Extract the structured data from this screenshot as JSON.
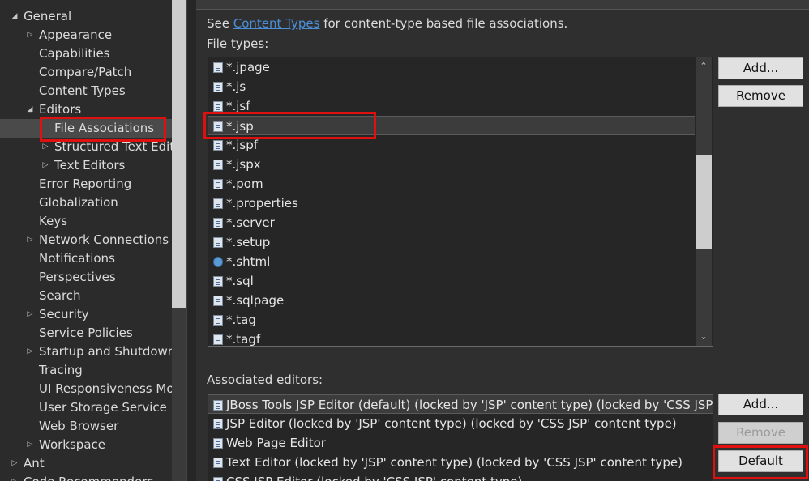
{
  "tree": {
    "items": [
      {
        "label": "General",
        "arrow": "◢"
      },
      {
        "label": "Appearance",
        "arrow": "▷"
      },
      {
        "label": "Capabilities",
        "arrow": ""
      },
      {
        "label": "Compare/Patch",
        "arrow": ""
      },
      {
        "label": "Content Types",
        "arrow": ""
      },
      {
        "label": "Editors",
        "arrow": "◢"
      },
      {
        "label": "File Associations",
        "arrow": ""
      },
      {
        "label": "Structured Text Editors",
        "arrow": "▷"
      },
      {
        "label": "Text Editors",
        "arrow": "▷"
      },
      {
        "label": "Error Reporting",
        "arrow": ""
      },
      {
        "label": "Globalization",
        "arrow": ""
      },
      {
        "label": "Keys",
        "arrow": ""
      },
      {
        "label": "Network Connections",
        "arrow": "▷"
      },
      {
        "label": "Notifications",
        "arrow": ""
      },
      {
        "label": "Perspectives",
        "arrow": ""
      },
      {
        "label": "Search",
        "arrow": ""
      },
      {
        "label": "Security",
        "arrow": "▷"
      },
      {
        "label": "Service Policies",
        "arrow": ""
      },
      {
        "label": "Startup and Shutdown",
        "arrow": "▷"
      },
      {
        "label": "Tracing",
        "arrow": ""
      },
      {
        "label": "UI Responsiveness Monitoring",
        "arrow": ""
      },
      {
        "label": "User Storage Service",
        "arrow": ""
      },
      {
        "label": "Web Browser",
        "arrow": ""
      },
      {
        "label": "Workspace",
        "arrow": "▷"
      },
      {
        "label": "Ant",
        "arrow": "▷"
      },
      {
        "label": "Code Recommenders",
        "arrow": "▷"
      }
    ],
    "selected_label": "File Associations"
  },
  "intro": {
    "prefix": "See ",
    "link": "Content Types",
    "suffix": " for content-type based file associations."
  },
  "file_types": {
    "label": "File types:",
    "items": [
      "*.jpage",
      "*.js",
      "*.jsf",
      "*.jsp",
      "*.jspf",
      "*.jspx",
      "*.pom",
      "*.properties",
      "*.server",
      "*.setup",
      "*.shtml",
      "*.sql",
      "*.sqlpage",
      "*.tag",
      "*.tagf"
    ],
    "selected": "*.jsp",
    "icons": [
      "file-icon",
      "js-file-icon",
      "jsf-file-icon",
      "jsp-file-icon",
      "jsp-file-icon",
      "jsp-file-icon",
      "maven-file-icon",
      "properties-file-icon",
      "server-file-icon",
      "setup-file-icon",
      "globe-icon",
      "sql-file-icon",
      "sql-file-icon",
      "jsp-file-icon",
      "jsp-file-icon"
    ],
    "add_label": "Add...",
    "remove_label": "Remove"
  },
  "associated_editors": {
    "label": "Associated editors:",
    "items": [
      "JBoss Tools JSP Editor (default) (locked by 'JSP' content type) (locked by 'CSS JSP' content type)",
      "JSP Editor (locked by 'JSP' content type) (locked by 'CSS JSP' content type)",
      "Web Page Editor",
      "Text Editor (locked by 'JSP' content type) (locked by 'CSS JSP' content type)",
      "CSS JSP Editor (locked by 'CSS JSP' content type)"
    ],
    "icons": [
      "jsp-editor-icon",
      "file-icon",
      "web-page-editor-icon",
      "text-editor-icon",
      "css-jsp-editor-icon"
    ],
    "add_label": "Add...",
    "remove_label": "Remove",
    "default_label": "Default"
  },
  "colors": {
    "highlight": "#e01010",
    "link": "#4a90d9",
    "background": "#2f2f2f"
  }
}
